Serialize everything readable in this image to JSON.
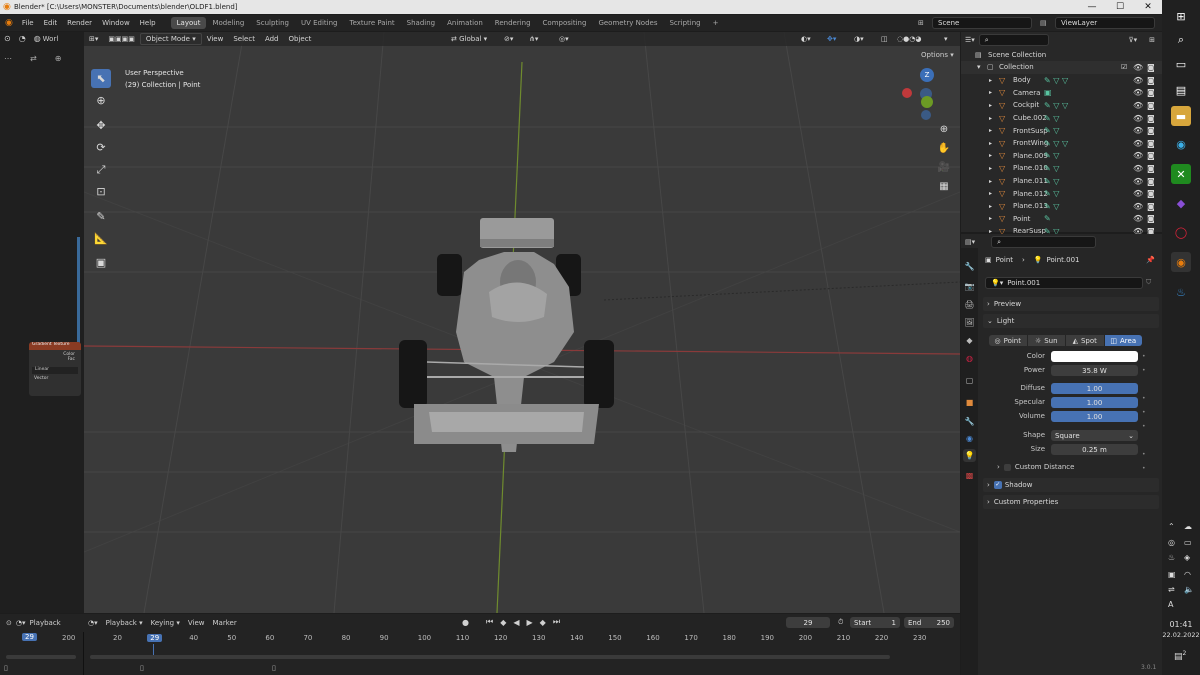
{
  "window": {
    "title": "Blender* [C:\\Users\\MONSTER\\Documents\\blender\\OLDF1.blend]",
    "minimize": "—",
    "maximize": "☐",
    "close": "✕"
  },
  "menu": [
    "File",
    "Edit",
    "Render",
    "Window",
    "Help"
  ],
  "workspaces": [
    "Layout",
    "Modeling",
    "Sculpting",
    "UV Editing",
    "Texture Paint",
    "Shading",
    "Animation",
    "Rendering",
    "Compositing",
    "Geometry Nodes",
    "Scripting"
  ],
  "workspace_add": "+",
  "scene": {
    "label": "Scene",
    "view_layer": "ViewLayer"
  },
  "left_strip": {
    "world_label": "Worl",
    "node": {
      "title": "Gradient Texture",
      "out1": "Color",
      "out2": "Fac",
      "dropdown": "Linear",
      "socket": "Vector"
    }
  },
  "viewport": {
    "mode": "Object Mode",
    "menus": [
      "View",
      "Select",
      "Add",
      "Object"
    ],
    "transform": "Global",
    "options": "Options",
    "info_line1": "User Perspective",
    "info_line2": "(29) Collection | Point",
    "gizmo": {
      "z": "Z",
      "y": "Y",
      "x": "X"
    }
  },
  "outliner": {
    "search_placeholder": "",
    "root": "Scene Collection",
    "collection": "Collection",
    "items": [
      {
        "name": "Body",
        "mods": "✎ ▽ ▽"
      },
      {
        "name": "Camera",
        "mods": "▣"
      },
      {
        "name": "Cockpit",
        "mods": "✎ ▽ ▽"
      },
      {
        "name": "Cube.002",
        "mods": "✎ ▽"
      },
      {
        "name": "FrontSusp",
        "mods": "✎ ▽"
      },
      {
        "name": "FrontWing",
        "mods": "✎ ▽ ▽"
      },
      {
        "name": "Plane.009",
        "mods": "✎ ▽"
      },
      {
        "name": "Plane.010",
        "mods": "✎ ▽"
      },
      {
        "name": "Plane.011",
        "mods": "✎ ▽"
      },
      {
        "name": "Plane.012",
        "mods": "✎ ▽"
      },
      {
        "name": "Plane.013",
        "mods": "✎ ▽"
      },
      {
        "name": "Point",
        "mods": "✎"
      },
      {
        "name": "RearSusp",
        "mods": "✎ ▽"
      }
    ]
  },
  "properties": {
    "breadcrumb_object": "Point",
    "breadcrumb_data": "Point.001",
    "datablock": "Point.001",
    "panels": {
      "preview": "Preview",
      "light": "Light",
      "custom_distance": "Custom Distance",
      "shadow": "Shadow",
      "custom_properties": "Custom Properties"
    },
    "light_types": [
      "Point",
      "Sun",
      "Spot",
      "Area"
    ],
    "active_light_type": "Area",
    "fields": {
      "color_label": "Color",
      "power_label": "Power",
      "power": "35.8 W",
      "diffuse_label": "Diffuse",
      "diffuse": "1.00",
      "specular_label": "Specular",
      "specular": "1.00",
      "volume_label": "Volume",
      "volume": "1.00",
      "shape_label": "Shape",
      "shape": "Square",
      "size_label": "Size",
      "size": "0.25 m"
    },
    "shadow_checked": true,
    "color_value": "#ffffff"
  },
  "timeline": {
    "menus": [
      "Playback",
      "Keying",
      "View",
      "Marker"
    ],
    "left_playback": "Playback",
    "current_frame": "29",
    "start_label": "Start",
    "start": "1",
    "end_label": "End",
    "end": "250",
    "ticks": [
      "20",
      "29",
      "40",
      "50",
      "60",
      "70",
      "80",
      "90",
      "100",
      "110",
      "120",
      "130",
      "140",
      "150",
      "160",
      "170",
      "180",
      "190",
      "200",
      "210",
      "220",
      "230"
    ],
    "left_ticks": [
      "29",
      "200"
    ],
    "version": "3.0.1"
  },
  "taskbar": {
    "time": "01:41",
    "date": "22.02.2022",
    "notif": "2"
  }
}
